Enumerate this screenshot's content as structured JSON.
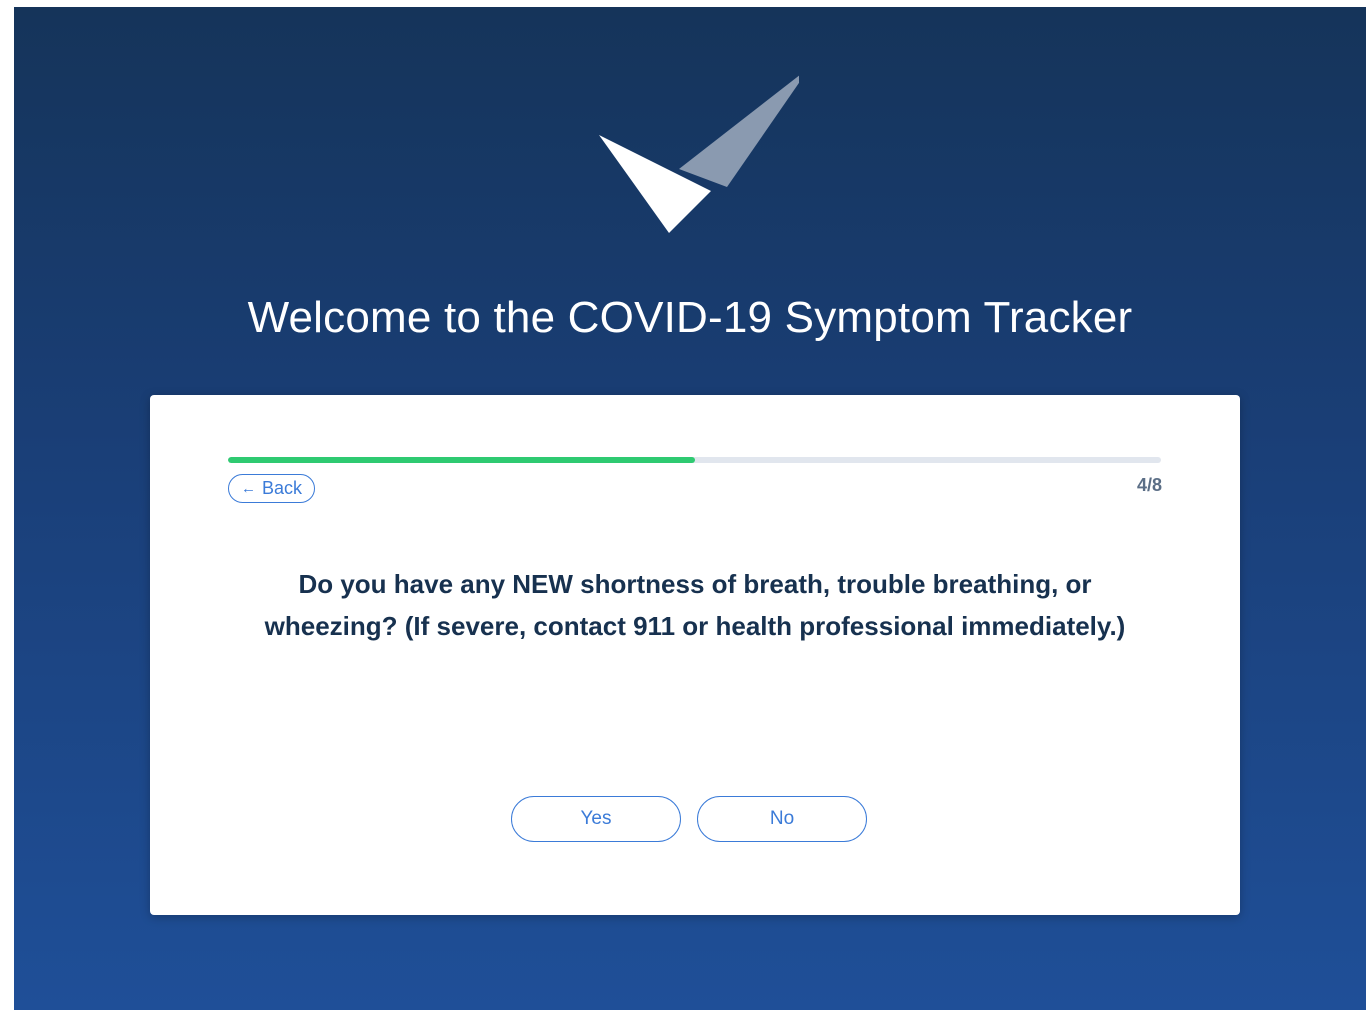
{
  "header": {
    "title": "Welcome to the COVID-19 Symptom Tracker",
    "logo_icon": "checkmark-logo-icon"
  },
  "progress": {
    "current_step": 4,
    "total_steps": 8,
    "step_label": "4/8",
    "fill_fraction": 0.5
  },
  "navigation": {
    "back_label": "Back",
    "back_icon": "arrow-left-icon"
  },
  "question": {
    "text": "Do you have any NEW shortness of breath, trouble breathing, or wheezing? (If severe, contact 911 or health professional immediately.)"
  },
  "answers": {
    "yes_label": "Yes",
    "no_label": "No"
  },
  "colors": {
    "background_top": "#15345a",
    "background_bottom": "#1f4f98",
    "accent": "#3b7bd8",
    "progress_fill": "#2fca71",
    "question_text": "#17314f"
  }
}
